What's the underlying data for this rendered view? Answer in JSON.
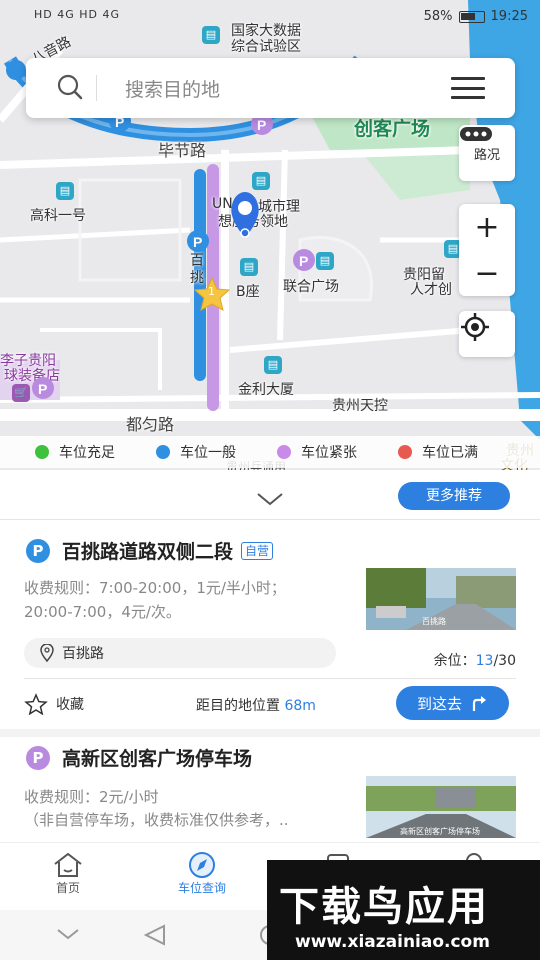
{
  "status": {
    "left": "HD 4G HD 4G",
    "battery": "58%",
    "time": "19:25"
  },
  "search": {
    "placeholder": "搜索目的地"
  },
  "map": {
    "labels": {
      "guojia": "国家大数据",
      "guojia2": "综合试验区",
      "bayin": "八音路",
      "chuangke": "创客广场",
      "bijie": "毕节路",
      "gaokeyi": "高科一号",
      "unc": "UN",
      "citymgmt": "城市理",
      "citymgmt2": "想服务领地",
      "baitiao": "百",
      "baitiao2": "挑",
      "bzuo": "B座",
      "lianhe": "联合广场",
      "guiyangliu": "贵阳留",
      "rencai": "人才创",
      "lizi": "李子贵阳",
      "qiuzhuang": "球装备店",
      "jinli": "金利大厦",
      "duyun": "都匀路",
      "tiankong": "贵州天控",
      "guizhouzhu": "贵州",
      "wenhua": "文化",
      "yuantong": "贵州兵通用",
      "star_num": "1"
    },
    "traffic_label": "路况",
    "zoom_in": "+",
    "zoom_out": "−"
  },
  "legend": [
    {
      "label": "车位充足",
      "color": "#3cc23c"
    },
    {
      "label": "车位一般",
      "color": "#2f8fe0"
    },
    {
      "label": "车位紧张",
      "color": "#c98be8"
    },
    {
      "label": "车位已满",
      "color": "#e85a4f"
    }
  ],
  "panel": {
    "more_label": "更多推荐",
    "card1": {
      "icon": "P",
      "title": "百挑路道路双侧二段",
      "tag": "自营",
      "fee_line1": "收费规则：7:00-20:00，1元/半小时；",
      "fee_line2": "20:00-7:00，4元/次。",
      "address": "百挑路",
      "remain_label": "余位：",
      "remain_free": "13",
      "remain_total": "/30",
      "fav_label": "收藏",
      "dist_label": "距目的地位置",
      "dist_value": "68m",
      "go_label": "到这去",
      "thumb_caption": "百挑路"
    },
    "card2": {
      "icon": "P",
      "title": "高新区创客广场停车场",
      "fee_line1": "收费规则：2元/小时",
      "fee_line2": "（非自营停车场，收费标准仅供参考，..",
      "thumb_caption": "高新区创客广场停车场"
    }
  },
  "tabs": [
    {
      "label": "首页",
      "active": false
    },
    {
      "label": "车位查询",
      "active": true
    }
  ],
  "ad": {
    "big": "下载鸟应用",
    "url": "www.xiazainiao.com"
  },
  "colors": {
    "accent": "#2d7fe0",
    "purple": "#b98be0"
  }
}
